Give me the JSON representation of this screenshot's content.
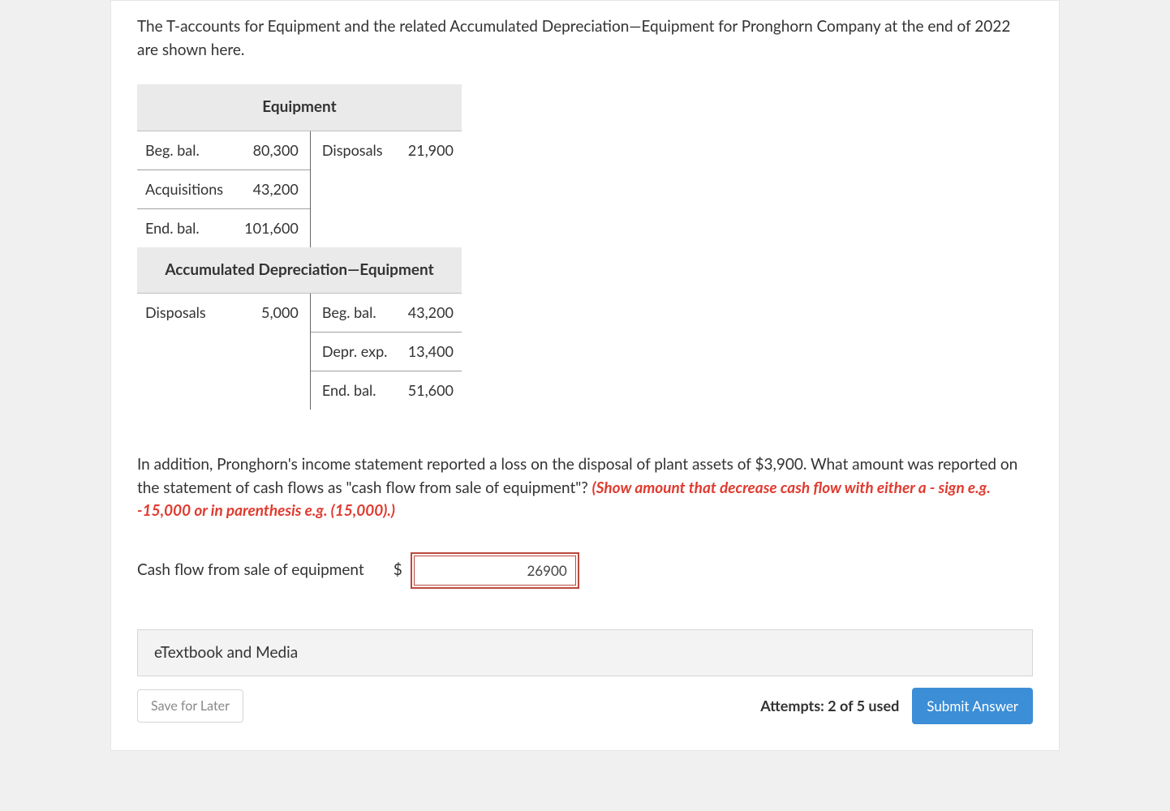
{
  "intro": "The T-accounts for Equipment and the related Accumulated Depreciation—Equipment for Pronghorn Company at the end of 2022 are shown here.",
  "t_accounts": {
    "equipment": {
      "header": "Equipment",
      "rows": [
        {
          "l_label": "Beg. bal.",
          "l_val": "80,300",
          "r_label": "Disposals",
          "r_val": "21,900"
        },
        {
          "l_label": "Acquisitions",
          "l_val": "43,200",
          "r_label": "",
          "r_val": ""
        },
        {
          "l_label": "End. bal.",
          "l_val": "101,600",
          "r_label": "",
          "r_val": ""
        }
      ]
    },
    "accum": {
      "header": "Accumulated Depreciation—Equipment",
      "rows": [
        {
          "l_label": "Disposals",
          "l_val": "5,000",
          "r_label": "Beg. bal.",
          "r_val": "43,200"
        },
        {
          "l_label": "",
          "l_val": "",
          "r_label": "Depr. exp.",
          "r_val": "13,400"
        },
        {
          "l_label": "",
          "l_val": "",
          "r_label": "End. bal.",
          "r_val": "51,600"
        }
      ]
    }
  },
  "question2": {
    "text": "In addition, Pronghorn's income statement reported a loss on the disposal of plant assets of $3,900. What amount was reported on the statement of cash flows as \"cash flow from sale of equipment\"? ",
    "instruction": "(Show amount that decrease cash flow with either a - sign e.g. -15,000 or in parenthesis e.g. (15,000).)"
  },
  "answer": {
    "label": "Cash flow from sale of equipment",
    "currency": "$",
    "value": "26900"
  },
  "resources_label": "eTextbook and Media",
  "footer": {
    "save_label": "Save for Later",
    "attempts_label": "Attempts: 2 of 5 used",
    "submit_label": "Submit Answer"
  }
}
